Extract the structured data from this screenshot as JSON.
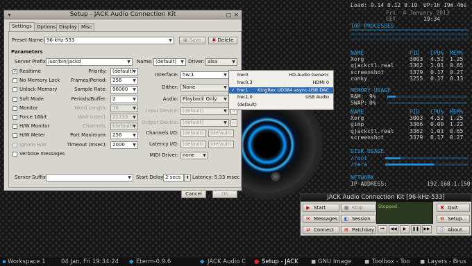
{
  "setup_window": {
    "title": "Setup - JACK Audio Connection Kit",
    "tabs": [
      "Settings",
      "Options",
      "Display",
      "Misc"
    ],
    "preset_label": "Preset Name:",
    "preset_value": "96-kHz-533",
    "save_label": "Save",
    "delete_label": "Delete",
    "parameters_heading": "Parameters",
    "server_prefix_label": "Server Prefix:",
    "server_prefix_value": "/usr/bin/jackd",
    "name_label": "Name:",
    "name_value": "(default)",
    "driver_label": "Driver:",
    "driver_value": "alsa",
    "checkboxes": [
      {
        "label": "Realtime",
        "checked": true,
        "enabled": true
      },
      {
        "label": "No Memory Lock",
        "checked": false,
        "enabled": true
      },
      {
        "label": "Unlock Memory",
        "checked": false,
        "enabled": true
      },
      {
        "label": "Soft Mode",
        "checked": false,
        "enabled": true
      },
      {
        "label": "Monitor",
        "checked": false,
        "enabled": true
      },
      {
        "label": "Force 16bit",
        "checked": false,
        "enabled": true
      },
      {
        "label": "H/W Monitor",
        "checked": false,
        "enabled": true
      },
      {
        "label": "H/W Meter",
        "checked": false,
        "enabled": true
      },
      {
        "label": "Ignore H/W",
        "checked": false,
        "enabled": false
      },
      {
        "label": "Verbose messages",
        "checked": false,
        "enabled": true
      }
    ],
    "mid_fields": [
      {
        "label": "Priority:",
        "value": "(default)",
        "enabled": true
      },
      {
        "label": "Frames/Period:",
        "value": "256",
        "enabled": true
      },
      {
        "label": "Sample Rate:",
        "value": "96000",
        "enabled": true
      },
      {
        "label": "Periods/Buffer:",
        "value": "2",
        "enabled": true
      },
      {
        "label": "Word Length:",
        "value": "16",
        "enabled": false
      },
      {
        "label": "Wait (usec):",
        "value": "21333",
        "enabled": false
      },
      {
        "label": "Channels:",
        "value": "(default)",
        "enabled": false
      },
      {
        "label": "Port Maximum:",
        "value": "256",
        "enabled": true
      },
      {
        "label": "Timeout (msec):",
        "value": "2000",
        "enabled": true
      }
    ],
    "right_fields": [
      {
        "label": "Interface:",
        "value": "hw:1",
        "enabled": true
      },
      {
        "label": "Dither:",
        "value": "None",
        "enabled": true
      },
      {
        "label": "Audio:",
        "value": "Playback Only",
        "enabled": true
      },
      {
        "label": "Input Device:",
        "value": "(default)",
        "enabled": false
      },
      {
        "label": "Output Device:",
        "value": "(default)",
        "enabled": false
      },
      {
        "label": "Channels I/O:",
        "value": "(default)",
        "value2": "(default)",
        "enabled": true
      },
      {
        "label": "Latency I/O:",
        "value": "(default)",
        "value2": "(default)",
        "enabled": true
      },
      {
        "label": "MIDI Driver:",
        "value": "none",
        "enabled": true
      }
    ],
    "server_suffix_label": "Server Suffix:",
    "server_suffix_value": "",
    "start_delay_label": "Start Delay:",
    "start_delay_value": "2 secs",
    "latency_label": "Latency: 5.33 msec",
    "cancel_label": "Cancel",
    "ok_label": "OK",
    "interface_dropdown": [
      {
        "id": "hw:0",
        "name": "HD-Audio Generic",
        "selected": false
      },
      {
        "id": "hw:0,3",
        "name": "HDMI 0",
        "selected": false
      },
      {
        "id": "hw:1",
        "name": "KingRex UD384 async-USB DAC",
        "selected": true
      },
      {
        "id": "hw:1,0",
        "name": "USB Audio",
        "selected": false
      },
      {
        "id": "(default)",
        "name": "",
        "selected": false
      }
    ]
  },
  "conky": {
    "load": "Load: 0.14 0.12 0.10",
    "uptime": "UP:1h 19m 46s",
    "date": "Fri  4 January 2013",
    "time": "19:34",
    "cet": "CET",
    "top_heading": "TOP PROCESSES",
    "cols": [
      "NAME",
      "PID",
      "CPU%",
      "MEM%"
    ],
    "cpu_procs": [
      [
        "Xorg",
        "3003",
        "4.52",
        "1.25"
      ],
      [
        "qjackctl.real",
        "3362",
        "1.01",
        "0.65"
      ],
      [
        "screenshot",
        "3379",
        "0.17",
        "0.27"
      ],
      [
        "conky",
        "3255",
        "0.17",
        "0.13"
      ]
    ],
    "mem_heading": "MEMORY USAGE",
    "ram": "RAM:",
    "ram_pct": "9%",
    "swap": "SWAP:",
    "swap_pct": "0%",
    "mem_procs": [
      [
        "Xorg",
        "3003",
        "4.52",
        "1.25"
      ],
      [
        "gimp",
        "3366",
        "0.00",
        "1.22"
      ],
      [
        "qjackctl.real",
        "3362",
        "1.01",
        "0.65"
      ],
      [
        "screenshot",
        "3379",
        "0.17",
        "0.27"
      ]
    ],
    "disk_heading": "DISK USAGE",
    "disks": [
      "/root",
      "/tera"
    ],
    "net_heading": "NETWORK",
    "ip_label": "IP ADDRESS:",
    "ip_value": "192.168.1.150"
  },
  "jack_window": {
    "title": "JACK Audio Connection Kit [96-kHz-533]",
    "start": "Start",
    "stop": "Stop",
    "messages": "Messages",
    "session": "Session",
    "connect": "Connect",
    "patchbay": "Patchbay",
    "quit": "Quit",
    "setup": "Setup...",
    "about": "About...",
    "display_status": "Stopped"
  },
  "taskbar": {
    "workspace": "Workspace 1",
    "datetime": "04 Jan, Fri 19:34:24",
    "items": [
      "Eterm-0.9.6",
      "JACK Audio C",
      "Setup - JACK",
      "GNU Image",
      "Toolbox - Too",
      "Layers - Brus"
    ]
  }
}
